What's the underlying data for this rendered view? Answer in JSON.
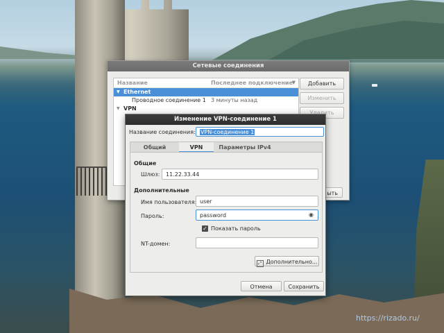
{
  "wallpaper": {
    "watermark": "https://rizado.ru/"
  },
  "connections_window": {
    "title": "Сетевые соединения",
    "columns": {
      "name": "Название",
      "last_used": "Последнее подключение"
    },
    "groups": [
      {
        "label": "Ethernet",
        "selected": true
      },
      {
        "label": "VPN",
        "selected": false
      }
    ],
    "rows": [
      {
        "name": "Проводное соединение 1",
        "last_used": "3 минуты назад"
      }
    ],
    "buttons": {
      "add": "Добавить",
      "edit": "Изменить",
      "delete": "Удалить",
      "close_partial": "ыть"
    }
  },
  "vpn_dialog": {
    "title": "Изменение VPN-соединение 1",
    "connection_name_label": "Название соединения:",
    "connection_name_value": "VPN-соединение 1",
    "tabs": [
      "Общий",
      "VPN",
      "Параметры IPv4"
    ],
    "active_tab": "VPN",
    "general_section": "Общие",
    "gateway_label": "Шлюз:",
    "gateway_value": "11.22.33.44",
    "advanced_section": "Дополнительные",
    "username_label": "Имя пользователя:",
    "username_value": "user",
    "password_label": "Пароль:",
    "password_value": "password",
    "show_password_label": "Показать пароль",
    "show_password_checked": true,
    "nt_domain_label": "NT-домен:",
    "nt_domain_value": "",
    "advanced_button": "Дополнительно...",
    "cancel_button": "Отмена",
    "save_button": "Сохранить",
    "accent_color": "#4a90d9"
  }
}
